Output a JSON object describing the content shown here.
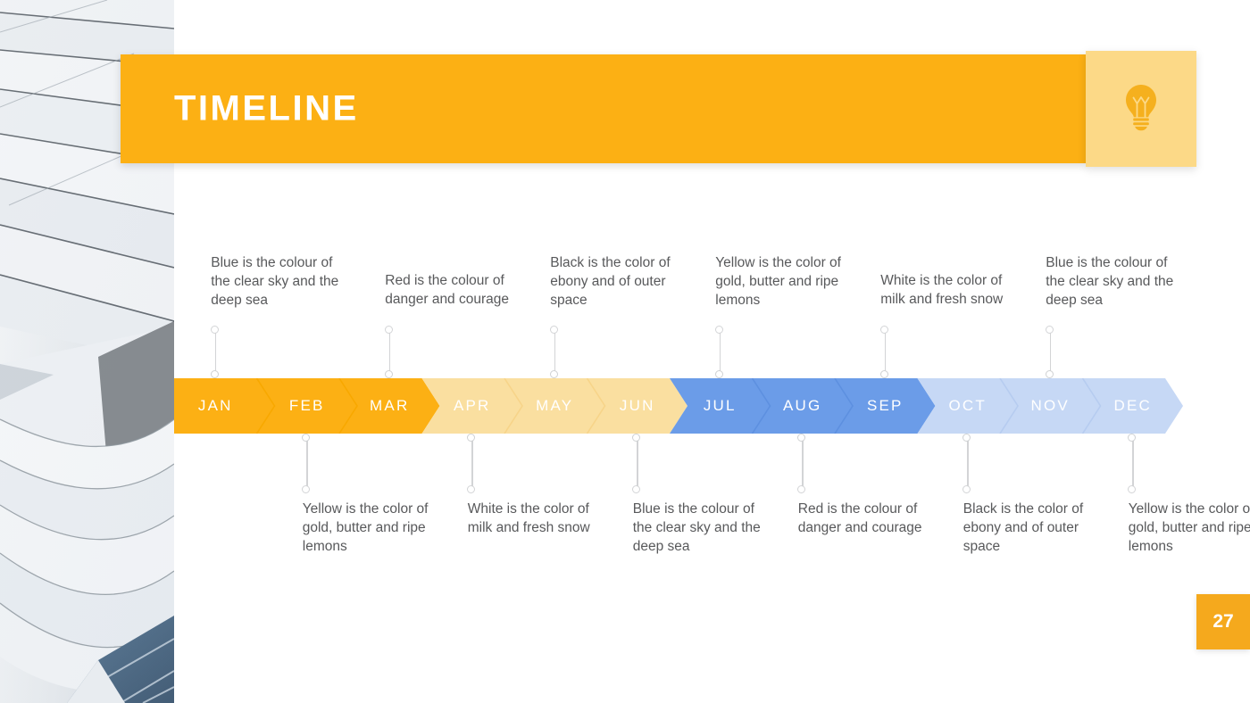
{
  "header": {
    "title": "TIMELINE",
    "icon": "lightbulb-icon",
    "bar_color": "#fcb014",
    "icon_panel_color": "#fcd987",
    "icon_glyph_color": "#f5b01e"
  },
  "page_badge": {
    "number": "27",
    "color": "#f5a91d"
  },
  "timeline": {
    "groups": [
      {
        "name": "q1",
        "fill": "#fcb014",
        "divider": "#f8a800"
      },
      {
        "name": "q2",
        "fill": "#fadfa0",
        "divider": "#f7d489"
      },
      {
        "name": "q3",
        "fill": "#6b9ce8",
        "divider": "#5d90e0"
      },
      {
        "name": "q4",
        "fill": "#c6d8f5",
        "divider": "#b6ccf0"
      }
    ],
    "months": [
      {
        "label": "JAN",
        "group": 0,
        "caption_side": "above"
      },
      {
        "label": "FEB",
        "group": 0,
        "caption_side": "below"
      },
      {
        "label": "MAR",
        "group": 0,
        "caption_side": "above"
      },
      {
        "label": "APR",
        "group": 1,
        "caption_side": "below"
      },
      {
        "label": "MAY",
        "group": 1,
        "caption_side": "above"
      },
      {
        "label": "JUN",
        "group": 1,
        "caption_side": "below"
      },
      {
        "label": "JUL",
        "group": 2,
        "caption_side": "above"
      },
      {
        "label": "AUG",
        "group": 2,
        "caption_side": "below"
      },
      {
        "label": "SEP",
        "group": 2,
        "caption_side": "above"
      },
      {
        "label": "OCT",
        "group": 3,
        "caption_side": "below"
      },
      {
        "label": "NOV",
        "group": 3,
        "caption_side": "above"
      },
      {
        "label": "DEC",
        "group": 3,
        "caption_side": "below"
      }
    ]
  },
  "captions": {
    "above": [
      {
        "month": "JAN",
        "text": "Blue is the colour of the clear sky and the deep sea"
      },
      {
        "month": "MAR",
        "text": "Red is the colour of danger and courage"
      },
      {
        "month": "MAY",
        "text": "Black is the color of ebony and of outer space"
      },
      {
        "month": "JUL",
        "text": "Yellow is the color of gold, butter and ripe lemons"
      },
      {
        "month": "SEP",
        "text": "White is the color of milk and fresh snow"
      },
      {
        "month": "NOV",
        "text": "Blue is the colour of the clear sky and the deep sea"
      }
    ],
    "below": [
      {
        "month": "FEB",
        "text": "Yellow is the color of gold, butter and ripe lemons"
      },
      {
        "month": "APR",
        "text": "White is the color of milk and fresh snow"
      },
      {
        "month": "JUN",
        "text": "Blue is the colour of the clear sky and the deep sea"
      },
      {
        "month": "AUG",
        "text": "Red is the colour of danger and courage"
      },
      {
        "month": "OCT",
        "text": "Black is the color of ebony and of outer space"
      },
      {
        "month": "DEC",
        "text": "Yellow is the color of gold, butter and ripe lemons"
      }
    ]
  },
  "photo": {
    "alt": "architectural-building-panels-photo"
  }
}
